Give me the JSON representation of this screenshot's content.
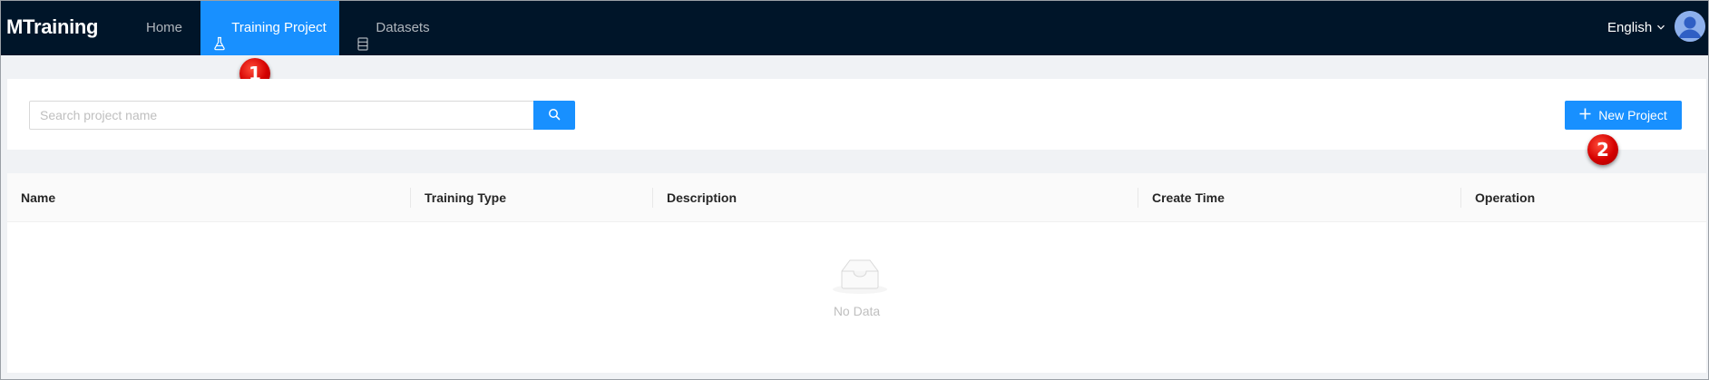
{
  "app": {
    "brand": "MTraining"
  },
  "nav": {
    "items": [
      {
        "label": "Home",
        "active": false
      },
      {
        "label": "Training Project",
        "active": true,
        "icon": "flask-icon"
      },
      {
        "label": "Datasets",
        "active": false,
        "icon": "database-icon"
      }
    ]
  },
  "header": {
    "language": "English",
    "avatar_icon": "user-avatar-icon"
  },
  "annotations": {
    "badge_1": "1",
    "badge_2": "2"
  },
  "search": {
    "placeholder": "Search project name",
    "value": "",
    "button_icon": "search-icon"
  },
  "toolbar": {
    "new_project_label": "New Project"
  },
  "table": {
    "columns": [
      "Name",
      "Training Type",
      "Description",
      "Create Time",
      "Operation"
    ],
    "rows": [],
    "empty_text": "No Data"
  },
  "colors": {
    "topbar": "#001529",
    "accent": "#1890ff",
    "badge": "#d40000"
  }
}
